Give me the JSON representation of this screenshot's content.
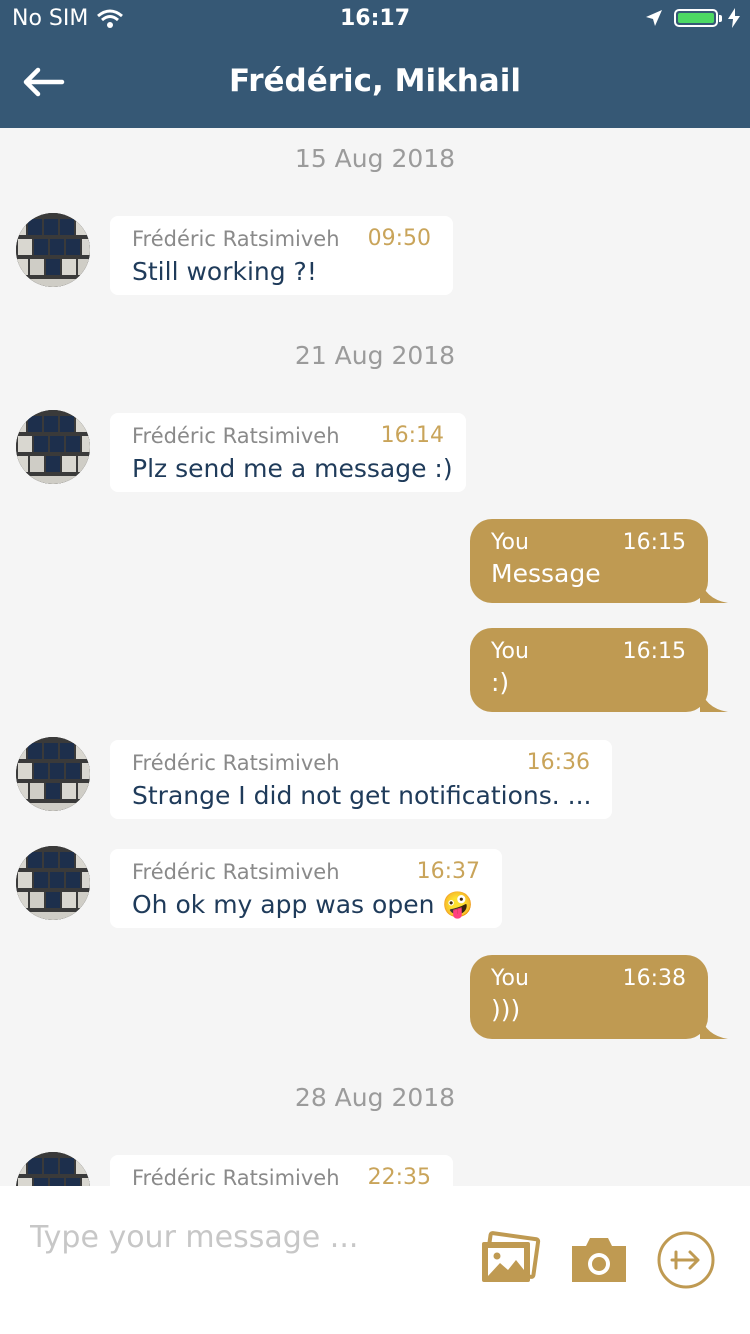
{
  "status": {
    "carrier": "No SIM",
    "time": "16:17"
  },
  "header": {
    "title": "Frédéric, Mikhail"
  },
  "messages": {
    "date1": "15 Aug 2018",
    "m1": {
      "sender": "Frédéric Ratsimiveh",
      "time": "09:50",
      "text": "Still working ?!"
    },
    "date2": "21 Aug 2018",
    "m2": {
      "sender": "Frédéric Ratsimiveh",
      "time": "16:14",
      "text": "Plz send me a message :)"
    },
    "m3": {
      "sender": "You",
      "time": "16:15",
      "text": "Message"
    },
    "m4": {
      "sender": "You",
      "time": "16:15",
      "text": ":)"
    },
    "m5": {
      "sender": "Frédéric Ratsimiveh",
      "time": "16:36",
      "text": "Strange I did not get notifications. ..."
    },
    "m6": {
      "sender": "Frédéric Ratsimiveh",
      "time": "16:37",
      "text": "Oh ok my app was open 🤪"
    },
    "m7": {
      "sender": "You",
      "time": "16:38",
      "text": ")))"
    },
    "date3": "28 Aug 2018",
    "m8": {
      "sender": "Frédéric Ratsimiveh",
      "time": "22:35"
    }
  },
  "composer": {
    "placeholder": "Type your message ..."
  },
  "icons": {
    "gallery": "photo-gallery-icon",
    "camera": "camera-icon",
    "send": "send-arrow-icon"
  },
  "colors": {
    "header": "#365875",
    "accent": "#bf9a52",
    "message_text": "#1f3b5a"
  }
}
